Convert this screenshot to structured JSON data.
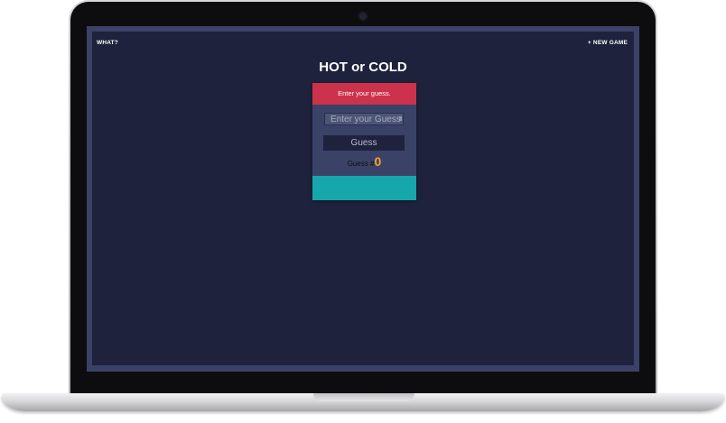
{
  "nav": {
    "what_label": "WHAT?",
    "new_game_label": "+ NEW GAME"
  },
  "title": "HOT or COLD",
  "card": {
    "header_text": "Enter your guess.",
    "input": {
      "placeholder": "Enter your Guess",
      "value": ""
    },
    "guess_button_label": "Guess",
    "counter": {
      "label": "Guess #",
      "value": "0"
    },
    "feedback_text": ""
  },
  "colors": {
    "background": "#1e223c",
    "card": "#3b4268",
    "header": "#cc324b",
    "feedback": "#15a7ac",
    "counter_number": "#f4a42c"
  }
}
